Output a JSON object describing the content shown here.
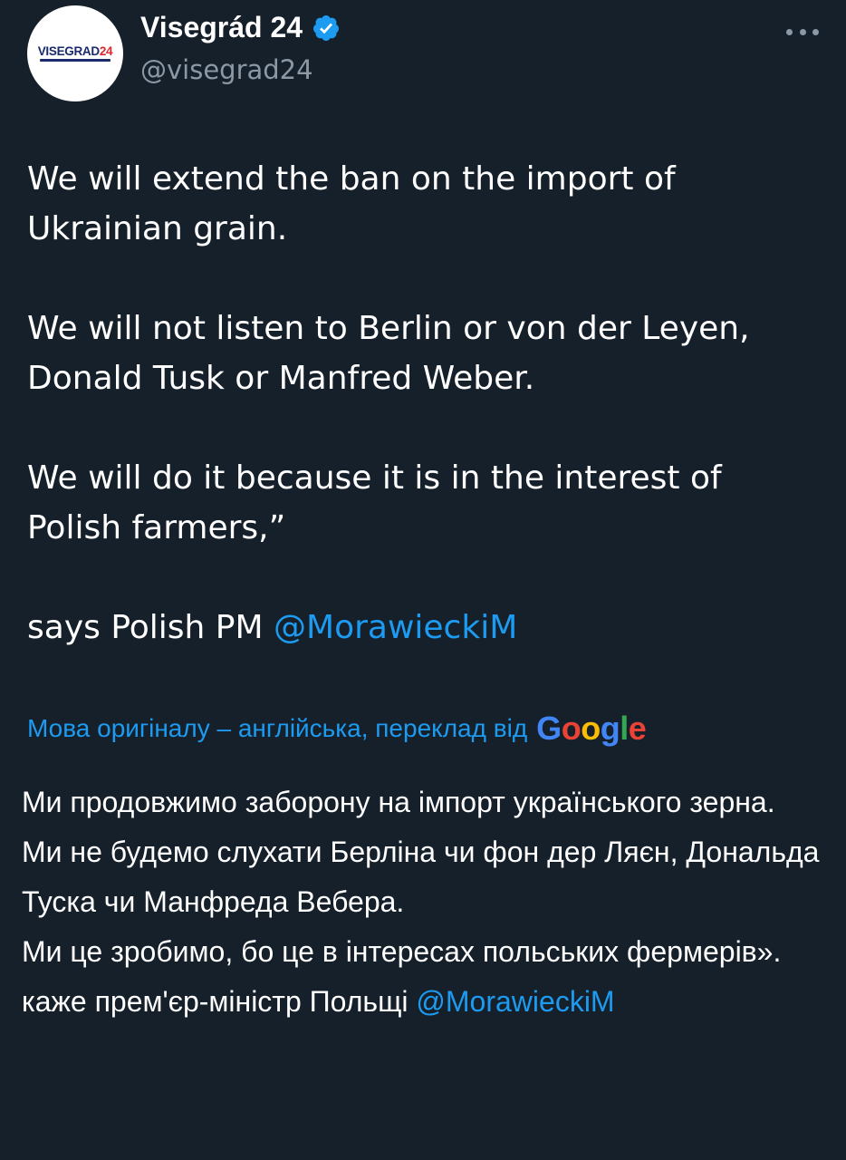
{
  "tweet": {
    "display_name": "Visegrád 24",
    "handle": "@visegrad24",
    "avatar_logo": {
      "text": "VISEGRAD",
      "number": "24"
    },
    "verified_icon": "verified-badge-icon",
    "more_icon": "more-dots-icon",
    "original_paragraphs": [
      "We will extend the ban on the import of Ukrainian grain.",
      "We will not listen to Berlin or von der Leyen, Donald Tusk or Manfred Weber.",
      "We will do it because it is in the interest of Polish farmers,”"
    ],
    "final_line_prefix": "says Polish PM ",
    "mention": "@MorawieckiM",
    "translation_label": "Мова оригіналу – англійська, переклад від",
    "translation_provider": "Google",
    "translated_paragraphs": [
      "Ми продовжимо заборону на імпорт українського зерна.",
      "Ми не будемо слухати Берліна чи фон дер Ляєн, Дональда Туска чи Манфреда Вебера.",
      "Ми це зробимо, бо це в інтересах польських фермерів»."
    ],
    "translated_final_prefix": "каже прем'єр-міністр Польщі ",
    "translated_mention": "@MorawieckiM"
  },
  "colors": {
    "background": "#15202b",
    "accent": "#1d9bf0",
    "secondary_text": "#8b98a5"
  }
}
